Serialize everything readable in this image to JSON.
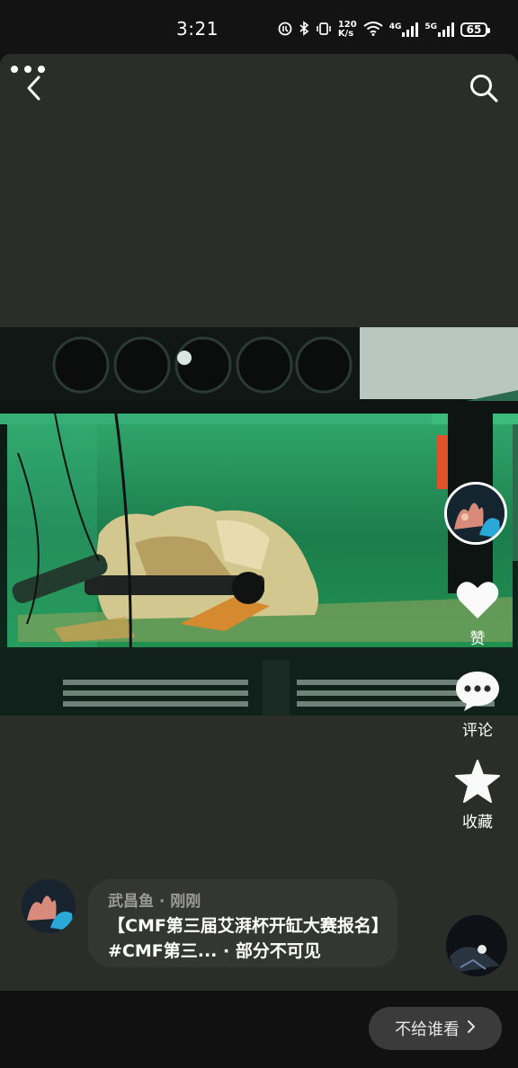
{
  "status_bar": {
    "time": "3:21",
    "net_speed_top": "120",
    "net_speed_bottom": "K/s",
    "net_4g": "4G",
    "net_5g": "5G",
    "battery": "65"
  },
  "header": {
    "back_icon": "chevron-left-icon",
    "search_icon": "search-icon"
  },
  "actions": {
    "like_label": "赞",
    "comment_label": "评论",
    "favorite_label": "收藏"
  },
  "post": {
    "meta": "武昌鱼 · 刚刚",
    "text": "【CMF第三届艾湃杯开缸大赛报名】#CMF第三... · 部分不可见"
  },
  "footer": {
    "visibility_label": "不给谁看"
  },
  "colors": {
    "card_background": "#2a2d28",
    "tank_water": "#1f8a55",
    "accent_orange": "#e0532a"
  }
}
